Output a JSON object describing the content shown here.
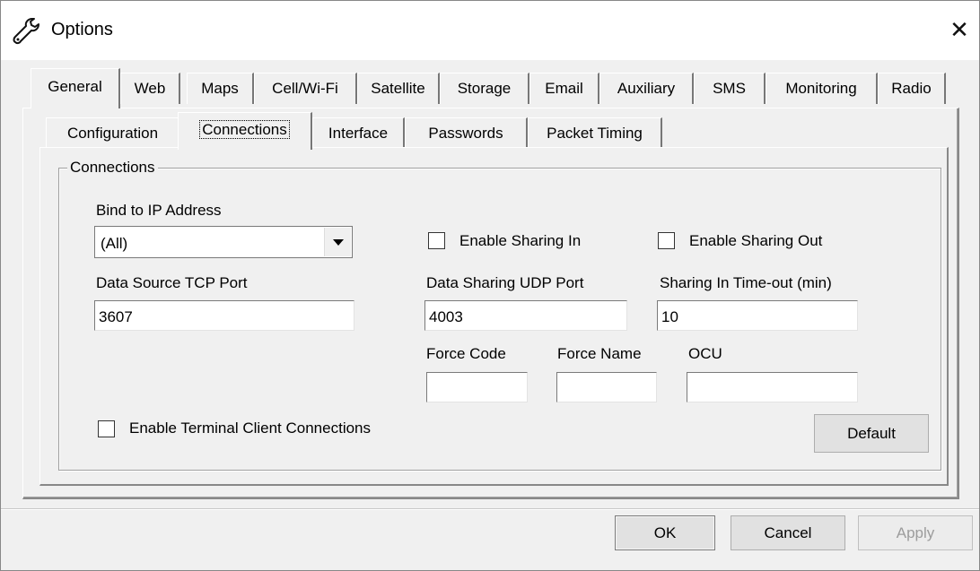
{
  "window": {
    "title": "Options",
    "icon": "wrench-icon",
    "close_label": "✕"
  },
  "tabs": [
    {
      "label": "General",
      "active": true
    },
    {
      "label": "Web"
    },
    {
      "label": "Maps"
    },
    {
      "label": "Cell/Wi-Fi"
    },
    {
      "label": "Satellite"
    },
    {
      "label": "Storage"
    },
    {
      "label": "Email"
    },
    {
      "label": "Auxiliary"
    },
    {
      "label": "SMS"
    },
    {
      "label": "Monitoring"
    },
    {
      "label": "Radio"
    }
  ],
  "subtabs": [
    {
      "label": "Configuration"
    },
    {
      "label": "Connections",
      "active": true
    },
    {
      "label": "Interface"
    },
    {
      "label": "Passwords"
    },
    {
      "label": "Packet Timing"
    }
  ],
  "group": {
    "title": "Connections"
  },
  "bind_ip": {
    "label": "Bind to IP Address",
    "value": "(All)"
  },
  "tcp_port": {
    "label": "Data Source TCP Port",
    "value": "3607"
  },
  "sharing_in": {
    "label": "Enable Sharing In",
    "checked": false
  },
  "sharing_out": {
    "label": "Enable Sharing Out",
    "checked": false
  },
  "udp_port": {
    "label": "Data Sharing UDP Port",
    "value": "4003"
  },
  "sharing_timeout": {
    "label": "Sharing In Time-out (min)",
    "value": "10"
  },
  "force_code": {
    "label": "Force Code",
    "value": ""
  },
  "force_name": {
    "label": "Force Name",
    "value": ""
  },
  "ocu": {
    "label": "OCU",
    "value": ""
  },
  "terminal_client": {
    "label": "Enable Terminal Client Connections",
    "checked": false
  },
  "default_button": "Default",
  "footer": {
    "ok": "OK",
    "cancel": "Cancel",
    "apply": "Apply"
  }
}
